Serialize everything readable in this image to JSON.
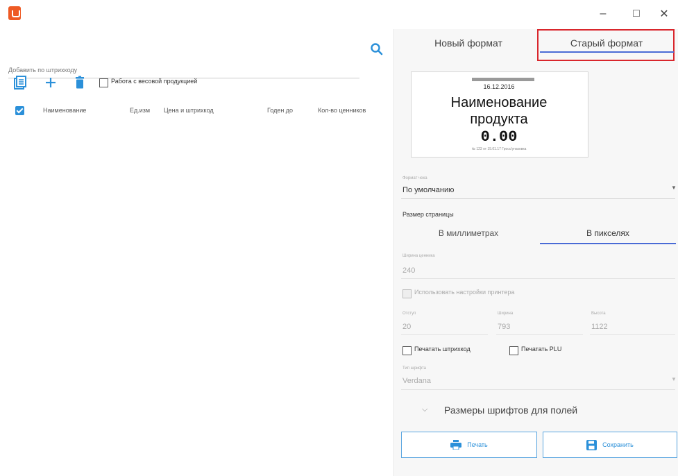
{
  "window": {
    "minimize": "–",
    "maximize": "□",
    "close": "✕"
  },
  "left": {
    "search_placeholder": "Добавить по штрихкоду",
    "weight_checkbox_label": "Работа с весовой продукцией",
    "columns": [
      "Наименование",
      "Ед.изм",
      "Цена и штрихкод",
      "Годен до",
      "Кол-во ценников"
    ]
  },
  "right": {
    "tabs": [
      "Новый формат",
      "Старый формат"
    ],
    "preview": {
      "date": "16.12.2016",
      "name_line1": "Наименование",
      "name_line2": "продукта",
      "price": "0.00",
      "footer": "№ 123 от 15.01.17 Гросс/упаковка"
    },
    "format_label": "Формат чека",
    "format_value": "По умолчанию",
    "page_size_label": "Размер страницы",
    "subtabs": [
      "В миллиметрах",
      "В пикселях"
    ],
    "width_label": "Ширина ценника",
    "width_value": "240",
    "use_printer_label": "Использовать настройки принтера",
    "field_labels": [
      "Отступ",
      "Ширина",
      "Высота"
    ],
    "field_values": [
      "20",
      "793",
      "1122"
    ],
    "print_barcode_label": "Печатать штрихкод",
    "print_plu_label": "Печатать PLU",
    "font_label": "Тип шрифта",
    "font_value": "Verdana",
    "font_sizes_label": "Размеры шрифтов для полей",
    "print_button": "Печать",
    "save_button": "Сохранить"
  },
  "colors": {
    "accent": "#2b90d9",
    "tab_highlight": "#d9262c",
    "app_icon": "#ee5a24"
  }
}
